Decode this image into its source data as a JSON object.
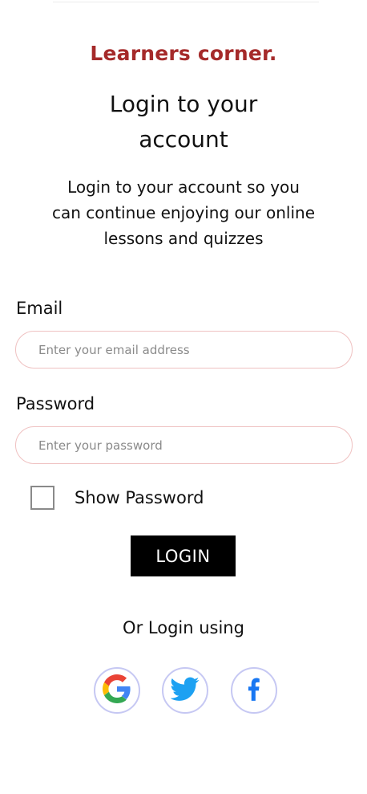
{
  "brand": "Learners corner.",
  "title": "Login to your account",
  "subtitle": "Login to your account so you can continue enjoying our online lessons and quizzes",
  "form": {
    "email_label": "Email",
    "email_placeholder": "Enter your email address",
    "email_value": "",
    "password_label": "Password",
    "password_placeholder": "Enter your password",
    "password_value": "",
    "show_password_label": "Show Password",
    "show_password_checked": false,
    "login_label": "LOGIN"
  },
  "social": {
    "prompt": "Or Login using",
    "providers": [
      {
        "icon": "google-icon"
      },
      {
        "icon": "twitter-icon",
        "color": "#1DA1F2"
      },
      {
        "icon": "facebook-icon",
        "color": "#1877F2"
      }
    ]
  },
  "colors": {
    "brand": "#A52A2A",
    "input_border": "#EFC1C1",
    "button_bg": "#000000",
    "social_border": "#C6C8F3"
  }
}
